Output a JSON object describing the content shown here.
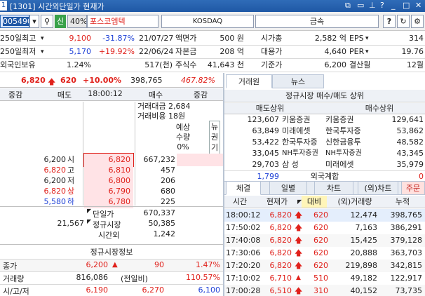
{
  "title": {
    "screen_no": "1",
    "text": "[1301] 시간외단일가 현재가",
    "icons": [
      "window-icon",
      "restore-icon",
      "pin-icon",
      "help-icon",
      "minimize-icon",
      "maximize-icon",
      "close-icon"
    ]
  },
  "toolbar": {
    "code": "005490",
    "badge": "신",
    "margin": "40%",
    "name": "포스코엠텍",
    "market": "KOSDAQ",
    "sector": "금속",
    "help": "?"
  },
  "info": {
    "rows": [
      {
        "label": "250일최고",
        "value": "9,100",
        "pct": "-31.87%",
        "date": "21/07/27",
        "k1": "액면가",
        "v1": "500 원",
        "k2": "시가총",
        "v2": "2,582 억",
        "k3": "EPS",
        "v3": "314"
      },
      {
        "label": "250일최저",
        "value": "5,170",
        "pct": "+19.92%",
        "date": "22/06/24",
        "k1": "자본금",
        "v1": "208 억",
        "k2": "대용가",
        "v2": "4,640",
        "k3": "PER",
        "v3": "19.76"
      },
      {
        "label": "외국인보유",
        "value": "1.24%",
        "pct": "",
        "date": "517(천)",
        "k1": "주식수",
        "v1": "41,643 천",
        "k2": "기준가",
        "v2": "6,200",
        "k3": "결산월",
        "v3": "12월"
      }
    ]
  },
  "quote": {
    "price": "6,820",
    "change": "620",
    "pct": "+10.00%",
    "volume": "398,765",
    "vol_pct": "467.82%"
  },
  "orderbook": {
    "headers": [
      "증감",
      "매도",
      "18:00:12",
      "매수",
      "증감"
    ],
    "summary": {
      "amount_label": "거래대금",
      "amount": "2,684",
      "cost_label": "거래비용",
      "cost": "18원"
    },
    "expected": {
      "l1": "예상",
      "l2": "수량",
      "l3": "0%"
    },
    "side_label": [
      "뉴",
      "권",
      "기"
    ],
    "asks": [
      {
        "ref": "6,200",
        "ref_label": "시",
        "price": "6,820",
        "qty": "667,232"
      },
      {
        "ref": "6,820",
        "ref_label": "고",
        "price": "6,810",
        "qty": "457"
      },
      {
        "ref": "6,200",
        "ref_label": "저",
        "price": "6,800",
        "qty": "206"
      },
      {
        "ref": "6,820",
        "ref_label": "상",
        "price": "6,790",
        "qty": "680"
      },
      {
        "ref": "5,580",
        "ref_label": "하",
        "price": "6,780",
        "qty": "225"
      }
    ],
    "bottom": {
      "single_label": "단일가",
      "single": "670,337",
      "total": "21,567",
      "regular_label": "정규시장",
      "regular": "50,385",
      "after_label": "시간외",
      "after": "1,242"
    }
  },
  "regular_info": {
    "title": "정규시장정보",
    "rows": [
      {
        "label": "종가",
        "v1": "6,200",
        "sym": "▲",
        "v2": "90",
        "v3": "1.47%"
      },
      {
        "label": "거래량",
        "v1": "816,086",
        "sym": "(전일비)",
        "v2": "",
        "v3": "110.57%"
      },
      {
        "label": "시/고/저",
        "v1": "6,190",
        "sym": "",
        "v2": "6,270",
        "v3": "6,100"
      }
    ]
  },
  "right_tabs": [
    "거래원",
    "뉴스"
  ],
  "brokers": {
    "title": "정규시장 매수/매도 상위",
    "sell_header": "매도상위",
    "buy_header": "매수상위",
    "rows": [
      {
        "sell_qty": "123,607",
        "sell_name": "키움증권",
        "buy_name": "키움증권",
        "buy_qty": "129,641"
      },
      {
        "sell_qty": "63,849",
        "sell_name": "미래에셋",
        "buy_name": "한국투자증",
        "buy_qty": "53,862"
      },
      {
        "sell_qty": "53,422",
        "sell_name": "한국투자증",
        "buy_name": "신한금융투",
        "buy_qty": "48,582"
      },
      {
        "sell_qty": "33,045",
        "sell_name": "NH투자증권",
        "buy_name": "NH투자증권",
        "buy_qty": "43,345"
      },
      {
        "sell_qty": "29,703",
        "sell_name": "삼 성",
        "buy_name": "미래에셋",
        "buy_qty": "35,979"
      }
    ],
    "foreign": {
      "qty": "1,799",
      "label": "외국계합",
      "buy": "0"
    }
  },
  "bottom_tabs": [
    "체결",
    "일별",
    "차트",
    "(외)차트",
    "주문"
  ],
  "ticks": {
    "headers": [
      "시간",
      "현재가",
      "대비",
      "(외)거래량",
      "누적"
    ],
    "rows": [
      {
        "time": "18:00:12",
        "price": "6,820",
        "chg": "620",
        "vol": "12,474",
        "acc": "398,765",
        "dir": "up"
      },
      {
        "time": "17:50:02",
        "price": "6,820",
        "chg": "620",
        "vol": "7,163",
        "acc": "386,291",
        "dir": "up"
      },
      {
        "time": "17:40:08",
        "price": "6,820",
        "chg": "620",
        "vol": "15,425",
        "acc": "379,128",
        "dir": "up"
      },
      {
        "time": "17:30:06",
        "price": "6,820",
        "chg": "620",
        "vol": "20,888",
        "acc": "363,703",
        "dir": "up"
      },
      {
        "time": "17:20:20",
        "price": "6,820",
        "chg": "620",
        "vol": "219,898",
        "acc": "342,815",
        "dir": "up"
      },
      {
        "time": "17:10:02",
        "price": "6,710",
        "chg": "510",
        "vol": "49,182",
        "acc": "122,917",
        "dir": "tri"
      },
      {
        "time": "17:00:28",
        "price": "6,510",
        "chg": "310",
        "vol": "40,152",
        "acc": "73,735",
        "dir": "up"
      }
    ]
  },
  "colors": {
    "up": "#e0211b",
    "down": "#1c3fd6",
    "title_bar": "#2563b0"
  }
}
